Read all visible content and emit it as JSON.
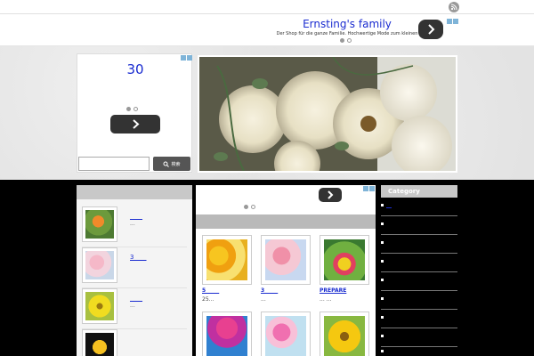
{
  "header_ad": {
    "title": "Ernsting's family",
    "subtitle": "Der Shop für die ganze Familie. Hochwertige Mode zum kleinen"
  },
  "side_ad": {
    "number": "30"
  },
  "search": {
    "button_label": "検索",
    "placeholder": ""
  },
  "sidebar_list": [
    {
      "link": "____",
      "excerpt": "..."
    },
    {
      "link": "3____",
      "excerpt": ""
    },
    {
      "link": "____",
      "excerpt": "..."
    },
    {
      "link": "",
      "excerpt": ""
    }
  ],
  "grid": [
    {
      "link": "5_____",
      "excerpt": "25..."
    },
    {
      "link": "3_____",
      "excerpt": "..."
    },
    {
      "link": "PREPARE",
      "excerpt": "...     ..."
    },
    {
      "link": "",
      "excerpt": ""
    },
    {
      "link": "",
      "excerpt": ""
    },
    {
      "link": "",
      "excerpt": ""
    }
  ],
  "category": {
    "title": "Category",
    "items": [
      "__",
      "",
      "",
      "",
      "",
      "",
      "",
      "",
      ""
    ]
  },
  "colors": {
    "link": "#1a2cd0",
    "ad_button": "#333333",
    "bar_gray": "#c8c8c8"
  }
}
